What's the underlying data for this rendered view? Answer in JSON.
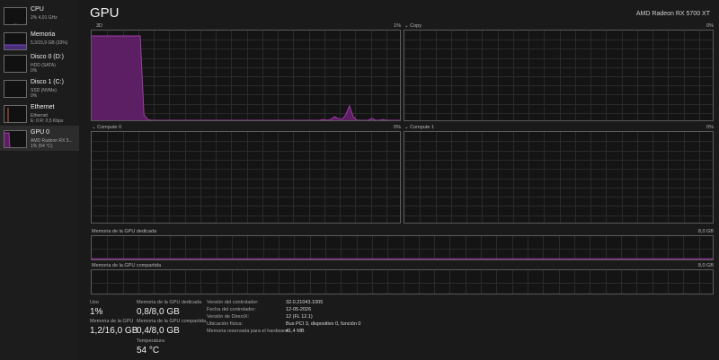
{
  "colors": {
    "background": "#1a1a1a",
    "gpu_accent": "#a03aa8",
    "gpu_fill": "#5c1f63",
    "cpu_accent": "#3a8ee6",
    "memory_accent": "#7a4cc2",
    "disk_accent": "#5aa02c",
    "ethernet_accent": "#c7654a"
  },
  "sidebar": {
    "items": [
      {
        "title": "CPU",
        "sub1": "2% 4,01 GHz",
        "sub2": "",
        "icon": "cpu-graph-thumbnail"
      },
      {
        "title": "Memoria",
        "sub1": "5,3/15,9 GB (33%)",
        "sub2": "",
        "icon": "memory-graph-thumbnail"
      },
      {
        "title": "Disco 0 (D:)",
        "sub1": "HDD (SATA)",
        "sub2": "0%",
        "icon": "disk-graph-thumbnail"
      },
      {
        "title": "Disco 1 (C:)",
        "sub1": "SSD (NVMe)",
        "sub2": "0%",
        "icon": "disk-graph-thumbnail"
      },
      {
        "title": "Ethernet",
        "sub1": "Ethernet",
        "sub2": "E: 0 R: 0,5 Kbps",
        "icon": "ethernet-graph-thumbnail"
      },
      {
        "title": "GPU 0",
        "sub1": "AMD Radeon RX 5...",
        "sub2": "1% (54 °C)",
        "icon": "gpu-graph-thumbnail"
      }
    ]
  },
  "header": {
    "title": "GPU",
    "adapter": "AMD Radeon RX 5700 XT"
  },
  "engines": [
    {
      "label": "3D",
      "pct": "1%"
    },
    {
      "label": "Copy",
      "pct": "0%"
    },
    {
      "label": "Compute 0",
      "pct": "0%"
    },
    {
      "label": "Compute 1",
      "pct": "0%"
    }
  ],
  "dedicated_memory": {
    "label": "Memoria de la GPU dedicada",
    "max": "8,0 GB"
  },
  "shared_memory": {
    "label": "Memoria de la GPU compartida",
    "max": "8,0 GB"
  },
  "stats": {
    "use_label": "Uso",
    "use_value": "1%",
    "gpu_mem_label": "Memoria de la GPU",
    "gpu_mem_value": "1,2/16,0 GB",
    "dedicated_label": "Memoria de la GPU dedicada",
    "dedicated_value": "0,8/8,0 GB",
    "shared_label": "Memoria de la GPU compartida",
    "shared_value": "0,4/8,0 GB",
    "temp_label": "Temperatura",
    "temp_value": "54 °C"
  },
  "info": [
    {
      "label": "Versión del controlador:",
      "value": "32.0.21043.1005"
    },
    {
      "label": "Fecha del controlador:",
      "value": "12-05-2026"
    },
    {
      "label": "Versión de DirectX:",
      "value": "12 (FL 12.1)"
    },
    {
      "label": "Ubicación física:",
      "value": "Bus PCI 3, dispositivo 0, función 0"
    },
    {
      "label": "Memoria reservada para el hardware:",
      "value": "41,4 MB"
    }
  ],
  "graph_levels": {
    "engine_3d_history_pct": [
      95,
      95,
      95,
      95,
      95,
      95,
      95,
      95,
      95,
      95,
      95,
      95,
      95,
      95,
      8,
      3,
      2,
      2,
      2,
      2,
      2,
      2,
      2,
      2,
      2,
      2,
      2,
      2,
      2,
      2,
      2,
      2,
      2,
      2,
      2,
      2,
      2,
      2,
      2,
      2,
      2,
      2,
      2,
      2,
      2,
      2,
      2,
      2,
      2,
      2,
      2,
      2,
      2,
      2,
      2,
      2,
      2,
      2,
      2,
      2,
      2,
      2,
      3,
      2,
      3,
      6,
      4,
      3,
      8,
      18,
      6,
      2,
      2,
      2,
      2,
      4,
      2,
      2,
      3,
      2,
      2,
      2,
      2,
      2
    ],
    "dedicated_memory_fraction": 0.1,
    "shared_memory_fraction": 0.05
  }
}
